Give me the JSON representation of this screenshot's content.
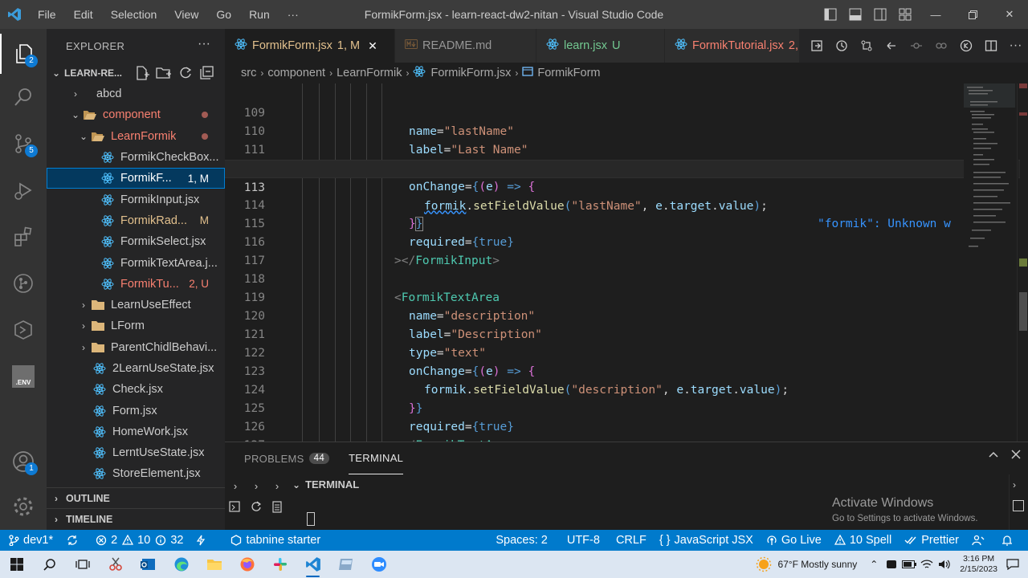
{
  "window": {
    "title": "FormikForm.jsx - learn-react-dw2-nitan - Visual Studio Code",
    "menu": [
      "File",
      "Edit",
      "Selection",
      "View",
      "Go",
      "Run",
      "···"
    ]
  },
  "activity": {
    "explorer_badge": "2",
    "scm_badge": "5",
    "accounts_badge": "1",
    "env_label": ".ENV"
  },
  "sidebar": {
    "title": "EXPLORER",
    "project": "LEARN-RE...",
    "tree": [
      {
        "label": "abcd",
        "kind": "folder",
        "status": ""
      },
      {
        "label": "component",
        "kind": "folder-open",
        "status": ""
      },
      {
        "label": "LearnFormik",
        "kind": "folder-open",
        "status": ""
      },
      {
        "label": "FormikCheckBox...",
        "kind": "react",
        "status": ""
      },
      {
        "label": "FormikF...",
        "kind": "react",
        "status": "1, M"
      },
      {
        "label": "FormikInput.jsx",
        "kind": "react",
        "status": ""
      },
      {
        "label": "FormikRad...",
        "kind": "react",
        "status": "M"
      },
      {
        "label": "FormikSelect.jsx",
        "kind": "react",
        "status": ""
      },
      {
        "label": "FormikTextArea.j...",
        "kind": "react",
        "status": ""
      },
      {
        "label": "FormikTu...",
        "kind": "react",
        "status": "2, U"
      },
      {
        "label": "LearnUseEffect",
        "kind": "folder",
        "status": ""
      },
      {
        "label": "LForm",
        "kind": "folder",
        "status": ""
      },
      {
        "label": "ParentChidlBehavi...",
        "kind": "folder",
        "status": ""
      },
      {
        "label": "2LearnUseState.jsx",
        "kind": "react",
        "status": ""
      },
      {
        "label": "Check.jsx",
        "kind": "react",
        "status": ""
      },
      {
        "label": "Form.jsx",
        "kind": "react",
        "status": ""
      },
      {
        "label": "HomeWork.jsx",
        "kind": "react",
        "status": ""
      },
      {
        "label": "LerntUseState.jsx",
        "kind": "react",
        "status": ""
      },
      {
        "label": "StoreElement.jsx",
        "kind": "react",
        "status": ""
      }
    ],
    "outline": "OUTLINE",
    "timeline": "TIMELINE"
  },
  "tabs": [
    {
      "label": "FormikForm.jsx",
      "status": "1, M",
      "active": true
    },
    {
      "label": "README.md",
      "status": "",
      "active": false
    },
    {
      "label": "learn.jsx",
      "status": "U",
      "active": false
    },
    {
      "label": "FormikTutorial.jsx",
      "status": "2, U",
      "active": false
    }
  ],
  "breadcrumb": [
    "src",
    "component",
    "LearnFormik",
    "FormikForm.jsx",
    "FormikForm"
  ],
  "editor": {
    "current_line": 113,
    "hint": "\"formik\": Unknown w",
    "lines": [
      {
        "n": 109,
        "text": "name=\"lastName\""
      },
      {
        "n": 110,
        "text": "label=\"Last Name\""
      },
      {
        "n": 111,
        "text": "type=\"text\""
      },
      {
        "n": 112,
        "text": "onChange={(e) => {"
      },
      {
        "n": 113,
        "text": "formik.setFieldValue(\"lastName\", e.target.value);"
      },
      {
        "n": 114,
        "text": "}}"
      },
      {
        "n": 115,
        "text": "required={true}"
      },
      {
        "n": 116,
        "text": "></FormikInput>"
      },
      {
        "n": 117,
        "text": ""
      },
      {
        "n": 118,
        "text": "<FormikTextArea"
      },
      {
        "n": 119,
        "text": "name=\"description\""
      },
      {
        "n": 120,
        "text": "label=\"Description\""
      },
      {
        "n": 121,
        "text": "type=\"text\""
      },
      {
        "n": 122,
        "text": "onChange={(e) => {"
      },
      {
        "n": 123,
        "text": "formik.setFieldValue(\"description\", e.target.value);"
      },
      {
        "n": 124,
        "text": "}}"
      },
      {
        "n": 125,
        "text": "required={true}"
      },
      {
        "n": 126,
        "text": "></FormikTextArea>"
      },
      {
        "n": 127,
        "text": ""
      }
    ]
  },
  "panel": {
    "problems_label": "PROBLEMS",
    "problems_count": "44",
    "terminal_label": "TERMINAL",
    "terminal_header": "TERMINAL",
    "activate_title": "Activate Windows",
    "activate_sub": "Go to Settings to activate Windows."
  },
  "status": {
    "branch": "dev1*",
    "errors": "2",
    "warnings": "10",
    "infos": "32",
    "tabnine": "tabnine starter",
    "spaces": "Spaces: 2",
    "encoding": "UTF-8",
    "eol": "CRLF",
    "language": "JavaScript JSX",
    "golive": "Go Live",
    "spell": "10 Spell",
    "prettier": "Prettier"
  },
  "taskbar": {
    "weather": "67°F  Mostly sunny",
    "time": "3:16 PM",
    "date": "2/15/2023"
  },
  "colors": {
    "statusbar": "#007acc",
    "activity_badge": "#0e7ad3",
    "modified": "#e2c08d",
    "untracked": "#73c991",
    "error_file": "#f88070"
  }
}
